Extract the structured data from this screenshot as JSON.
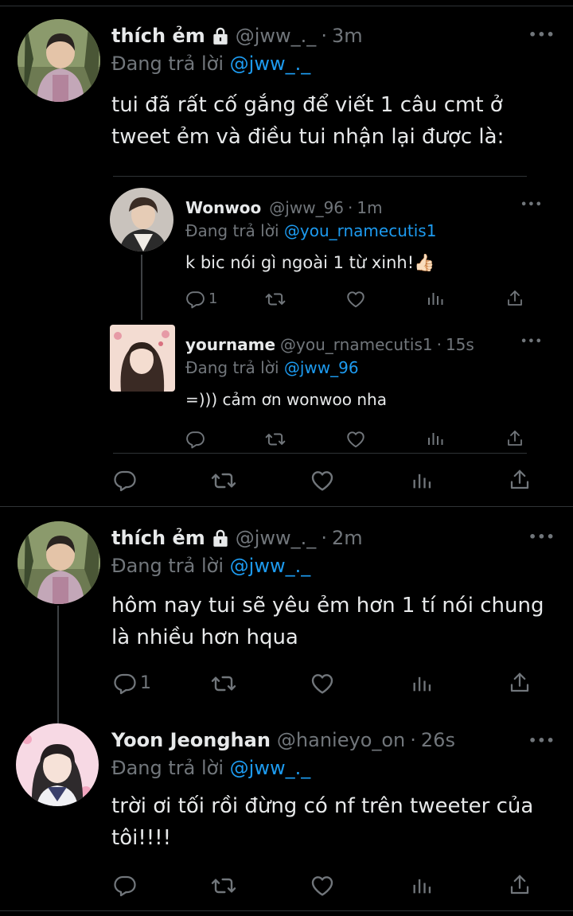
{
  "colors": {
    "background": "#000000",
    "text": "#e7e9ea",
    "muted": "#71767b",
    "accent": "#1d9bf0",
    "divider": "#2f3336"
  },
  "tweets": [
    {
      "name": "thích ẻm",
      "handle": "@jww_._",
      "time": "3m",
      "replying_prefix": "Đang trả lời",
      "replying_to": "@jww_._",
      "text": "tui đã rất cố gắng để viết 1 câu cmt ở tweet ẻm và điều tui nhận lại được là:",
      "quoted": [
        {
          "name": "Wonwoo",
          "handle": "@jww_96",
          "time": "1m",
          "replying_prefix": "Đang trả lời",
          "replying_to": "@you_rnamecutis1",
          "text": "k bic nói gì ngoài 1 từ xinh!👍🏻",
          "reply_count": "1"
        },
        {
          "name": "yourname",
          "handle": "@you_rnamecutis1",
          "time": "15s",
          "replying_prefix": "Đang trả lời",
          "replying_to": "@jww_96",
          "text": "=))) cảm ơn wonwoo nha",
          "reply_count": ""
        }
      ],
      "reply_count": ""
    },
    {
      "name": "thích ẻm",
      "handle": "@jww_._",
      "time": "2m",
      "replying_prefix": "Đang trả lời",
      "replying_to": "@jww_._",
      "text_line1": "hôm nay tui sẽ yêu ẻm hơn 1 tí nói chung",
      "text_line2": "là nhiều hơn hqua",
      "reply_count": "1"
    },
    {
      "name": "Yoon Jeonghan",
      "handle": "@hanieyo_on",
      "time": "26s",
      "replying_prefix": "Đang trả lời",
      "replying_to": "@jww_._",
      "text_line1": "trời ơi tối rồi đừng có nf trên tweeter của",
      "text_line2": "tôi!!!!",
      "reply_count": ""
    }
  ],
  "separator": "·",
  "more": "•••",
  "icons": [
    "lock-icon",
    "reply-icon",
    "retweet-icon",
    "like-icon",
    "views-icon",
    "share-icon",
    "more-icon"
  ]
}
